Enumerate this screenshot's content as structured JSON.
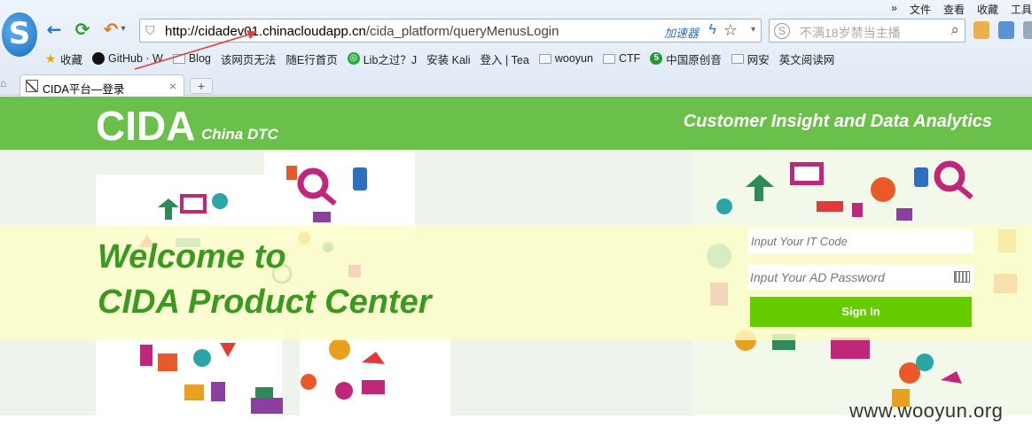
{
  "browser": {
    "top_menu": [
      "文件",
      "查看",
      "收藏",
      "工具"
    ],
    "top_menu_chevron": "»",
    "logo_letter": "S",
    "address": {
      "url_host": "http://cidadev01.chinacloudapp.cn",
      "url_path": "/cida_platform/queryMenusLogin",
      "accelerator": "加速器"
    },
    "search": {
      "placeholder": "不满18岁禁当主播"
    },
    "bookmarks": [
      {
        "label": "收藏",
        "icon": "star-icon"
      },
      {
        "label": "GitHub · W",
        "icon": "github-icon"
      },
      {
        "label": "Blog",
        "icon": "folder-icon"
      },
      {
        "label": "该网页无法",
        "icon": "page-icon"
      },
      {
        "label": "随E行首页",
        "icon": "page-icon"
      },
      {
        "label": "Lib之过？J",
        "icon": "wechat-icon"
      },
      {
        "label": "安装 Kali",
        "icon": "page-icon"
      },
      {
        "label": "登入 | Tea",
        "icon": "page-icon"
      },
      {
        "label": "wooyun",
        "icon": "folder-icon"
      },
      {
        "label": "CTF",
        "icon": "folder-icon"
      },
      {
        "label": "中国原创音",
        "icon": "5sing-icon"
      },
      {
        "label": "网安",
        "icon": "folder-icon"
      },
      {
        "label": "英文阅读网",
        "icon": "page-icon"
      }
    ],
    "tab": {
      "title": "CIDA平台—登录",
      "close": "×",
      "new_tab": "+"
    }
  },
  "page": {
    "brand": "CIDA",
    "brand_sub": "China DTC",
    "tagline": "Customer Insight and Data Analytics",
    "welcome_line1": "Welcome to",
    "welcome_line2": "CIDA Product Center",
    "login": {
      "it_code_placeholder": "Input Your IT Code",
      "password_placeholder": "Input Your AD Password",
      "sign_in_label": "Sign In"
    }
  },
  "watermark": "www.wooyun.org",
  "colors": {
    "header_green": "#6ac04b",
    "welcome_green": "#3a9a1e",
    "button_green": "#66cc00",
    "banner_yellow": "#fdfdc8",
    "annotation_red": "#e53a3a"
  }
}
